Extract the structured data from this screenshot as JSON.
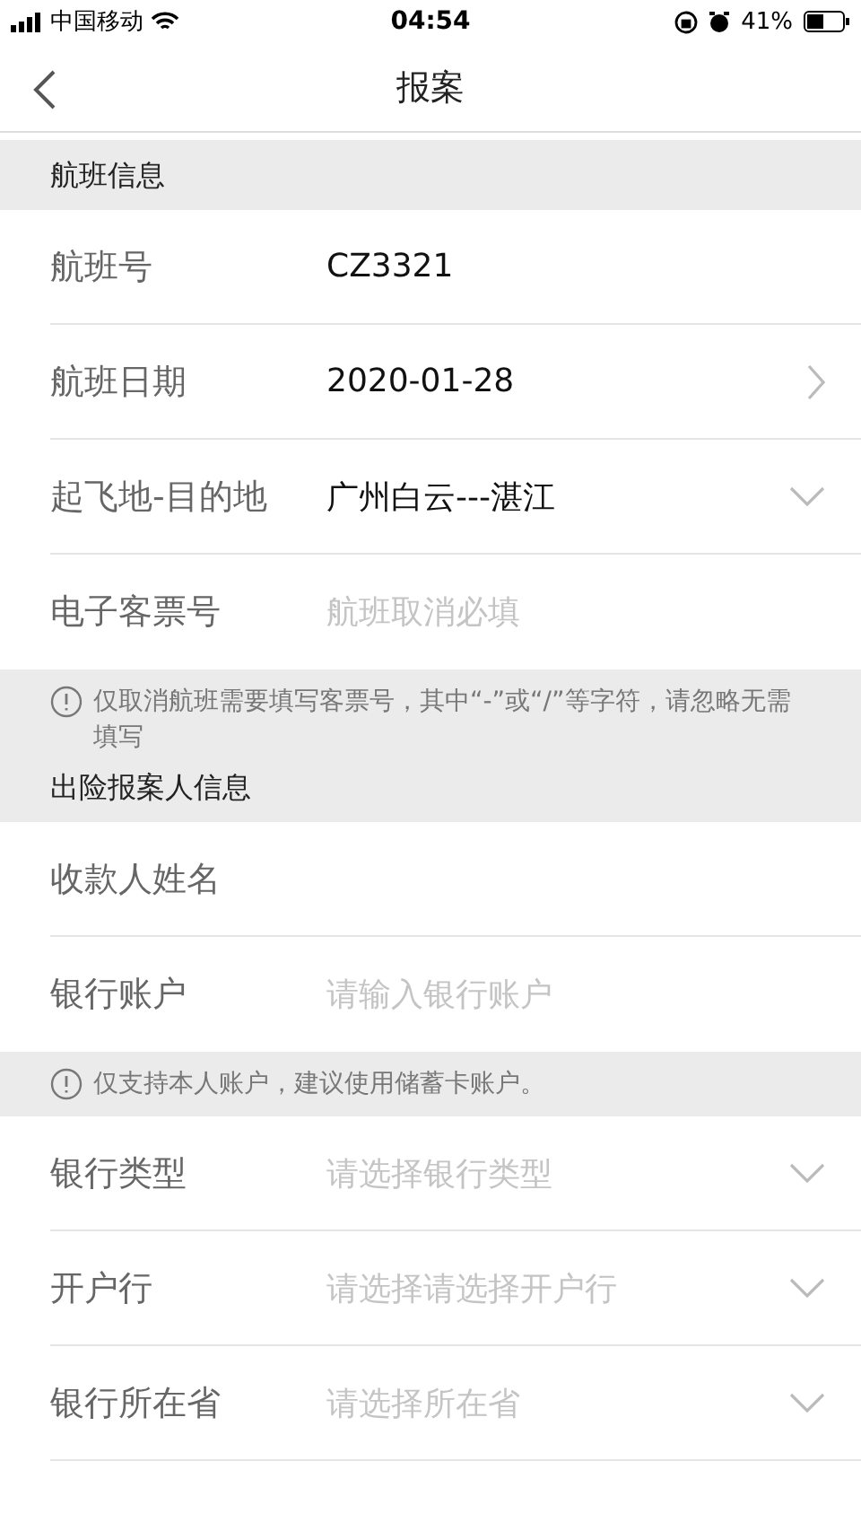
{
  "status_bar": {
    "carrier": "中国移动",
    "time": "04:54",
    "battery": "41%"
  },
  "nav": {
    "title": "报案"
  },
  "sections": [
    {
      "title": "航班信息",
      "rows": [
        {
          "kind": "text",
          "label": "航班号",
          "value": "CZ3321"
        },
        {
          "kind": "link",
          "label": "航班日期",
          "value": "2020-01-28"
        },
        {
          "kind": "select",
          "label": "起飞地-目的地",
          "value": "广州白云---湛江"
        },
        {
          "kind": "input",
          "label": "电子客票号",
          "placeholder": "航班取消必填"
        }
      ],
      "note": "仅取消航班需要填写客票号，其中“-”或“/”等字符，请忽略无需填写"
    },
    {
      "title": "出险报案人信息",
      "rows": [
        {
          "kind": "input",
          "label": "收款人姓名"
        },
        {
          "kind": "input",
          "label": "银行账户",
          "placeholder": "请输入银行账户"
        }
      ],
      "note": "仅支持本人账户，建议使用储蓄卡账户。"
    },
    {
      "rows": [
        {
          "kind": "select",
          "label": "银行类型",
          "placeholder": "请选择银行类型"
        },
        {
          "kind": "select",
          "label": "开户行",
          "placeholder": "请选择请选择开户行"
        },
        {
          "kind": "select",
          "label": "银行所在省",
          "placeholder": "请选择所在省"
        }
      ]
    }
  ]
}
